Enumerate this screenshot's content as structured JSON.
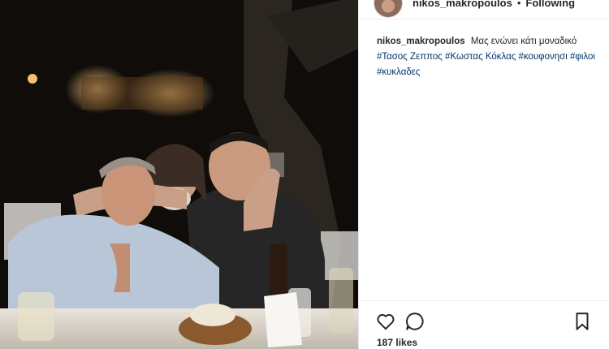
{
  "post": {
    "username": "nikos_makropoulos",
    "separator": "•",
    "follow_state": "Following",
    "caption": {
      "username": "nikos_makropoulos",
      "text": "Μας ενώνει κάτι μοναδικό",
      "hashtags": [
        "#Τασος Ζεππος",
        "#Κωστας Κόκλας",
        "#κουφονησι",
        "#φιλοι",
        "#κυκλαδες"
      ]
    },
    "likes": "187 likes"
  },
  "icons": {
    "like": "heart-icon",
    "comment": "comment-icon",
    "save": "bookmark-icon"
  },
  "colors": {
    "link": "#003569",
    "text": "#262626"
  }
}
